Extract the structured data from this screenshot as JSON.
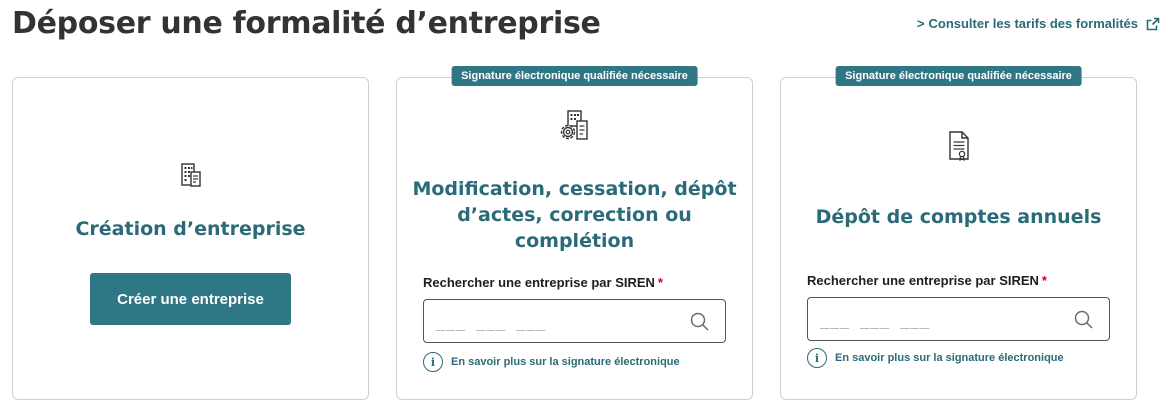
{
  "header": {
    "title": "Déposer une formalité d’entreprise",
    "tarifs_chevron": ">",
    "tarifs_link": "Consulter les tarifs des formalités"
  },
  "cards": [
    {
      "title": "Création d’entreprise",
      "button_label": "Créer une entreprise",
      "icon": "building-document-icon"
    },
    {
      "badge": "Signature électronique qualifiée nécessaire",
      "title_lines": [
        "Modification, cessation, dépôt",
        "d’actes, correction ou",
        "complétion"
      ],
      "search_label": "Rechercher une entreprise par SIREN",
      "required_mark": "*",
      "search_placeholder": "___ ___ ___",
      "info_icon_glyph": "i",
      "info_text": "En savoir plus sur la signature électronique",
      "icon": "building-gear-icon"
    },
    {
      "badge": "Signature électronique qualifiée nécessaire",
      "title": "Dépôt de comptes annuels",
      "search_label": "Rechercher une entreprise par SIREN",
      "required_mark": "*",
      "search_placeholder": "___ ___ ___",
      "info_icon_glyph": "i",
      "info_text": "En savoir plus sur la signature électronique",
      "icon": "certified-document-icon"
    }
  ],
  "colors": {
    "primary": "#2f7785",
    "link": "#2a6a79",
    "title": "#333333",
    "required": "#d0021b",
    "border": "#cfcfcf"
  }
}
